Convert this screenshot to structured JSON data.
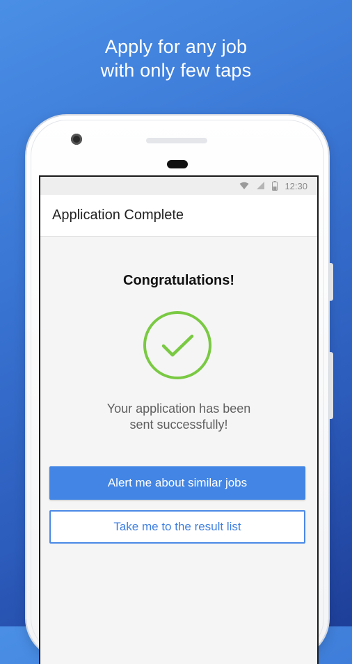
{
  "headline": {
    "line1": "Apply for any job",
    "line2": "with only few taps"
  },
  "status_bar": {
    "time": "12:30",
    "icons": [
      "wifi-icon",
      "signal-icon",
      "battery-icon"
    ]
  },
  "app_bar": {
    "title": "Application Complete"
  },
  "main": {
    "congrats": "Congratulations!",
    "check_icon": "check-circle-icon",
    "message_line1": "Your application has been",
    "message_line2": "sent successfully!",
    "primary_button": "Alert me about similar jobs",
    "secondary_button": "Take me to the result list"
  },
  "colors": {
    "background_top": "#4a8fe6",
    "background_bottom": "#1e3f99",
    "accent_blue": "#4285e4",
    "success_green": "#7ac943",
    "screen_bg": "#f5f5f5"
  }
}
